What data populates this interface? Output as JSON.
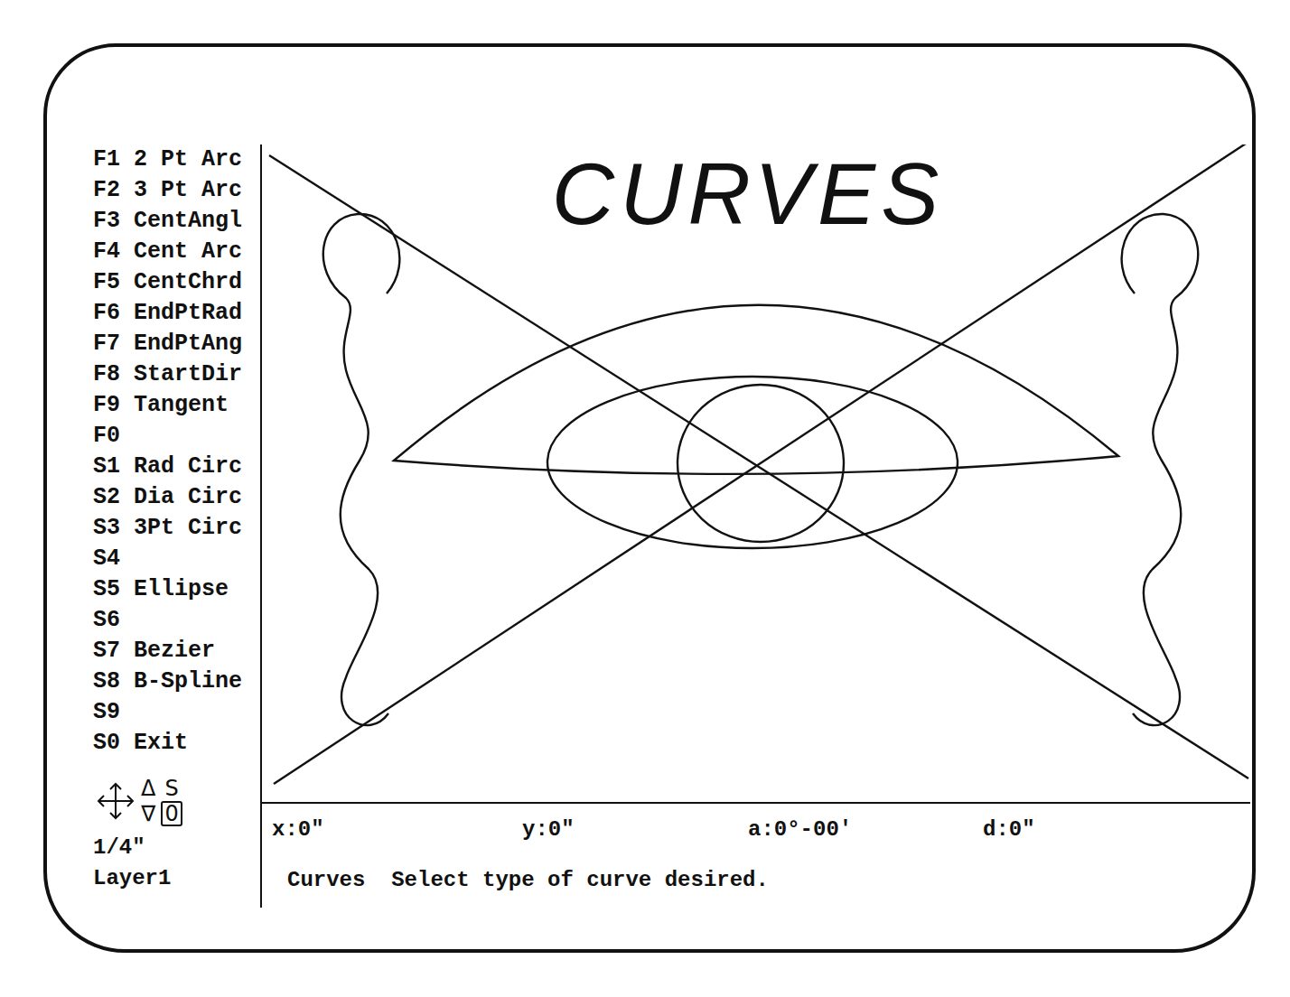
{
  "drawing": {
    "title": "CURVES"
  },
  "menu": [
    {
      "key": "F1",
      "label": "2 Pt Arc"
    },
    {
      "key": "F2",
      "label": "3 Pt Arc"
    },
    {
      "key": "F3",
      "label": "CentAngl"
    },
    {
      "key": "F4",
      "label": "Cent Arc"
    },
    {
      "key": "F5",
      "label": "CentChrd"
    },
    {
      "key": "F6",
      "label": "EndPtRad"
    },
    {
      "key": "F7",
      "label": "EndPtAng"
    },
    {
      "key": "F8",
      "label": "StartDir"
    },
    {
      "key": "F9",
      "label": "Tangent"
    },
    {
      "key": "F0",
      "label": ""
    },
    {
      "key": "S1",
      "label": "Rad Circ"
    },
    {
      "key": "S2",
      "label": "Dia Circ"
    },
    {
      "key": "S3",
      "label": "3Pt Circ"
    },
    {
      "key": "S4",
      "label": ""
    },
    {
      "key": "S5",
      "label": "Ellipse"
    },
    {
      "key": "S6",
      "label": ""
    },
    {
      "key": "S7",
      "label": "Bezier"
    },
    {
      "key": "S8",
      "label": "B-Spline"
    },
    {
      "key": "S9",
      "label": ""
    },
    {
      "key": "S0",
      "label": "Exit"
    }
  ],
  "cursor_keys": {
    "up": "Δ",
    "down": "∇",
    "snap": "S",
    "mode": "0"
  },
  "scale": "1/4\"",
  "layer": "Layer1",
  "readouts": [
    "x:0\"",
    "y:0\"",
    "a:0°-00'",
    "d:0\""
  ],
  "prompt": {
    "mode": "Curves",
    "message": "Select type of curve desired."
  }
}
